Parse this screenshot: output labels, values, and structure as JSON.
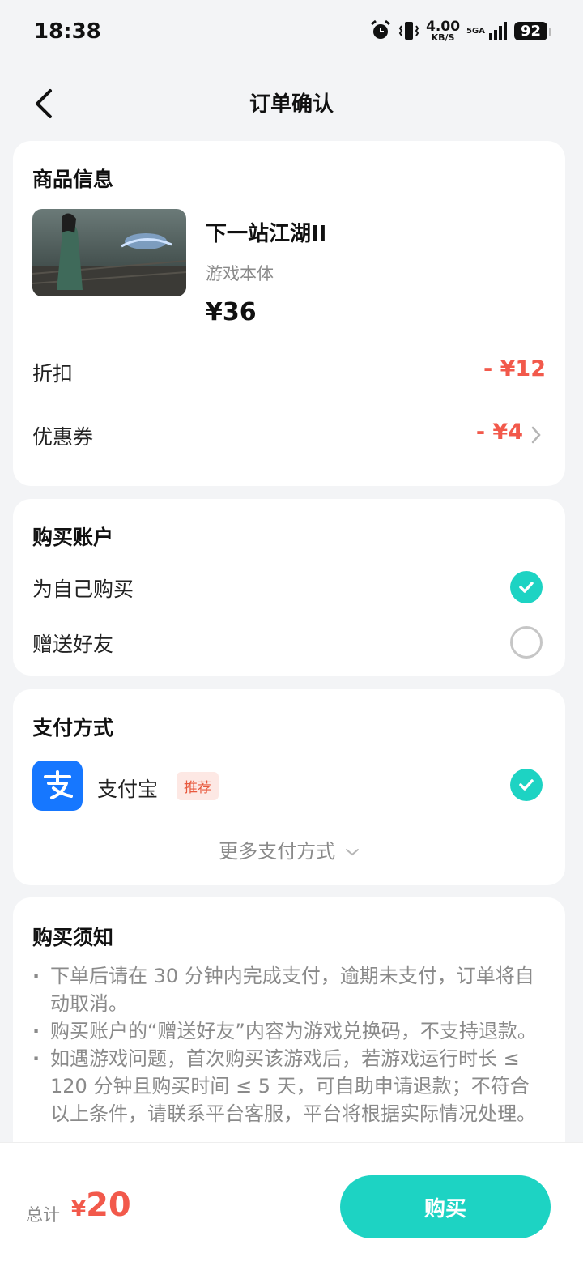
{
  "status_bar": {
    "time": "18:38",
    "net_speed_value": "4.00",
    "net_speed_unit": "KB/S",
    "net_type": "5GA",
    "battery": "92"
  },
  "header": {
    "title": "订单确认"
  },
  "product_card": {
    "section_title": "商品信息",
    "product_name": "下一站江湖II",
    "product_type": "游戏本体",
    "price": "¥36",
    "discount_label": "折扣",
    "discount_value": "- ¥12",
    "coupon_label": "优惠券",
    "coupon_value": "- ¥4"
  },
  "account_card": {
    "section_title": "购买账户",
    "options": [
      {
        "label": "为自己购买",
        "selected": true
      },
      {
        "label": "赠送好友",
        "selected": false
      }
    ]
  },
  "payment_card": {
    "section_title": "支付方式",
    "method_name": "支付宝",
    "method_tag": "推荐",
    "more_methods": "更多支付方式"
  },
  "notice_card": {
    "section_title": "购买须知",
    "items": [
      "下单后请在 30 分钟内完成支付，逾期未支付，订单将自动取消。",
      "购买账户的“赠送好友”内容为游戏兑换码，不支持退款。",
      "如遇游戏问题，首次购买该游戏后，若游戏运行时长 ≤ 120 分钟且购买时间 ≤ 5 天，可自助申请退款；不符合以上条件，请联系平台客服，平台将根据实际情况处理。"
    ]
  },
  "bottom_bar": {
    "total_label": "总计",
    "currency": "¥",
    "total_value": "20",
    "buy_label": "购买"
  },
  "colors": {
    "accent": "#1dd3c3",
    "price_red": "#f2594b",
    "alipay_blue": "#1677ff"
  }
}
